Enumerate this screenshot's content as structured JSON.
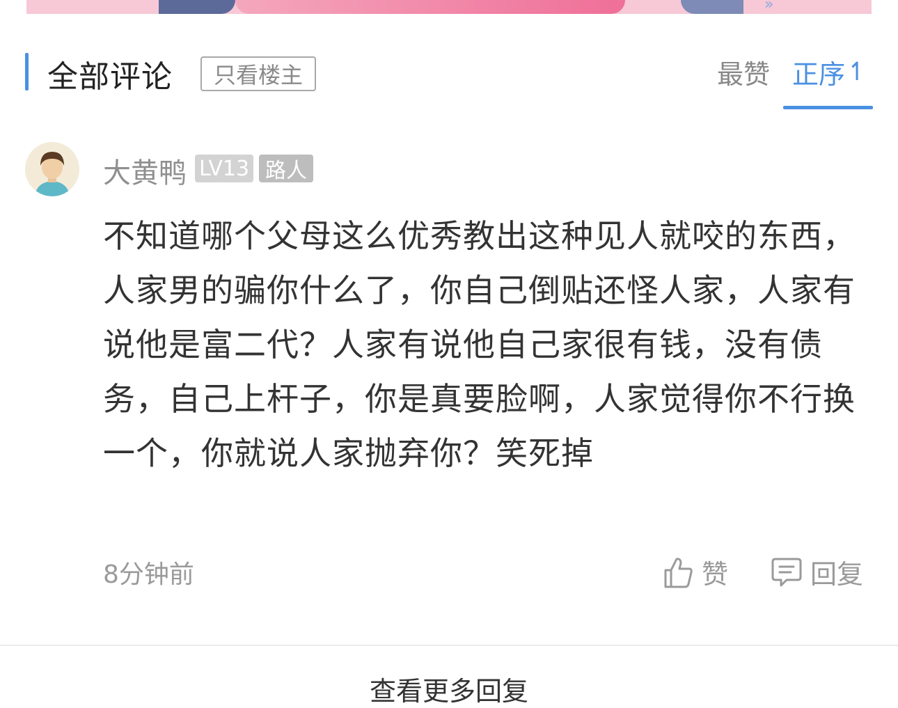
{
  "header": {
    "title": "全部评论",
    "filter_label": "只看楼主",
    "sort_hot": "最赞",
    "sort_asc": "正序",
    "sort_asc_arrow": "↿"
  },
  "comment": {
    "username": "大黄鸭",
    "level": "LV13",
    "role": "路人",
    "text": "不知道哪个父母这么优秀教出这种见人就咬的东西，人家男的骗你什么了，你自己倒贴还怪人家，人家有说他是富二代？人家有说他自己家很有钱，没有债务，自己上杆子，你是真要脸啊，人家觉得你不行换一个，你就说人家抛弃你？笑死掉",
    "time": "8分钟前",
    "like_label": "赞",
    "reply_label": "回复"
  },
  "footer": {
    "more_replies": "查看更多回复"
  },
  "colors": {
    "accent": "#4a90e2",
    "muted": "#9a9a9a"
  }
}
